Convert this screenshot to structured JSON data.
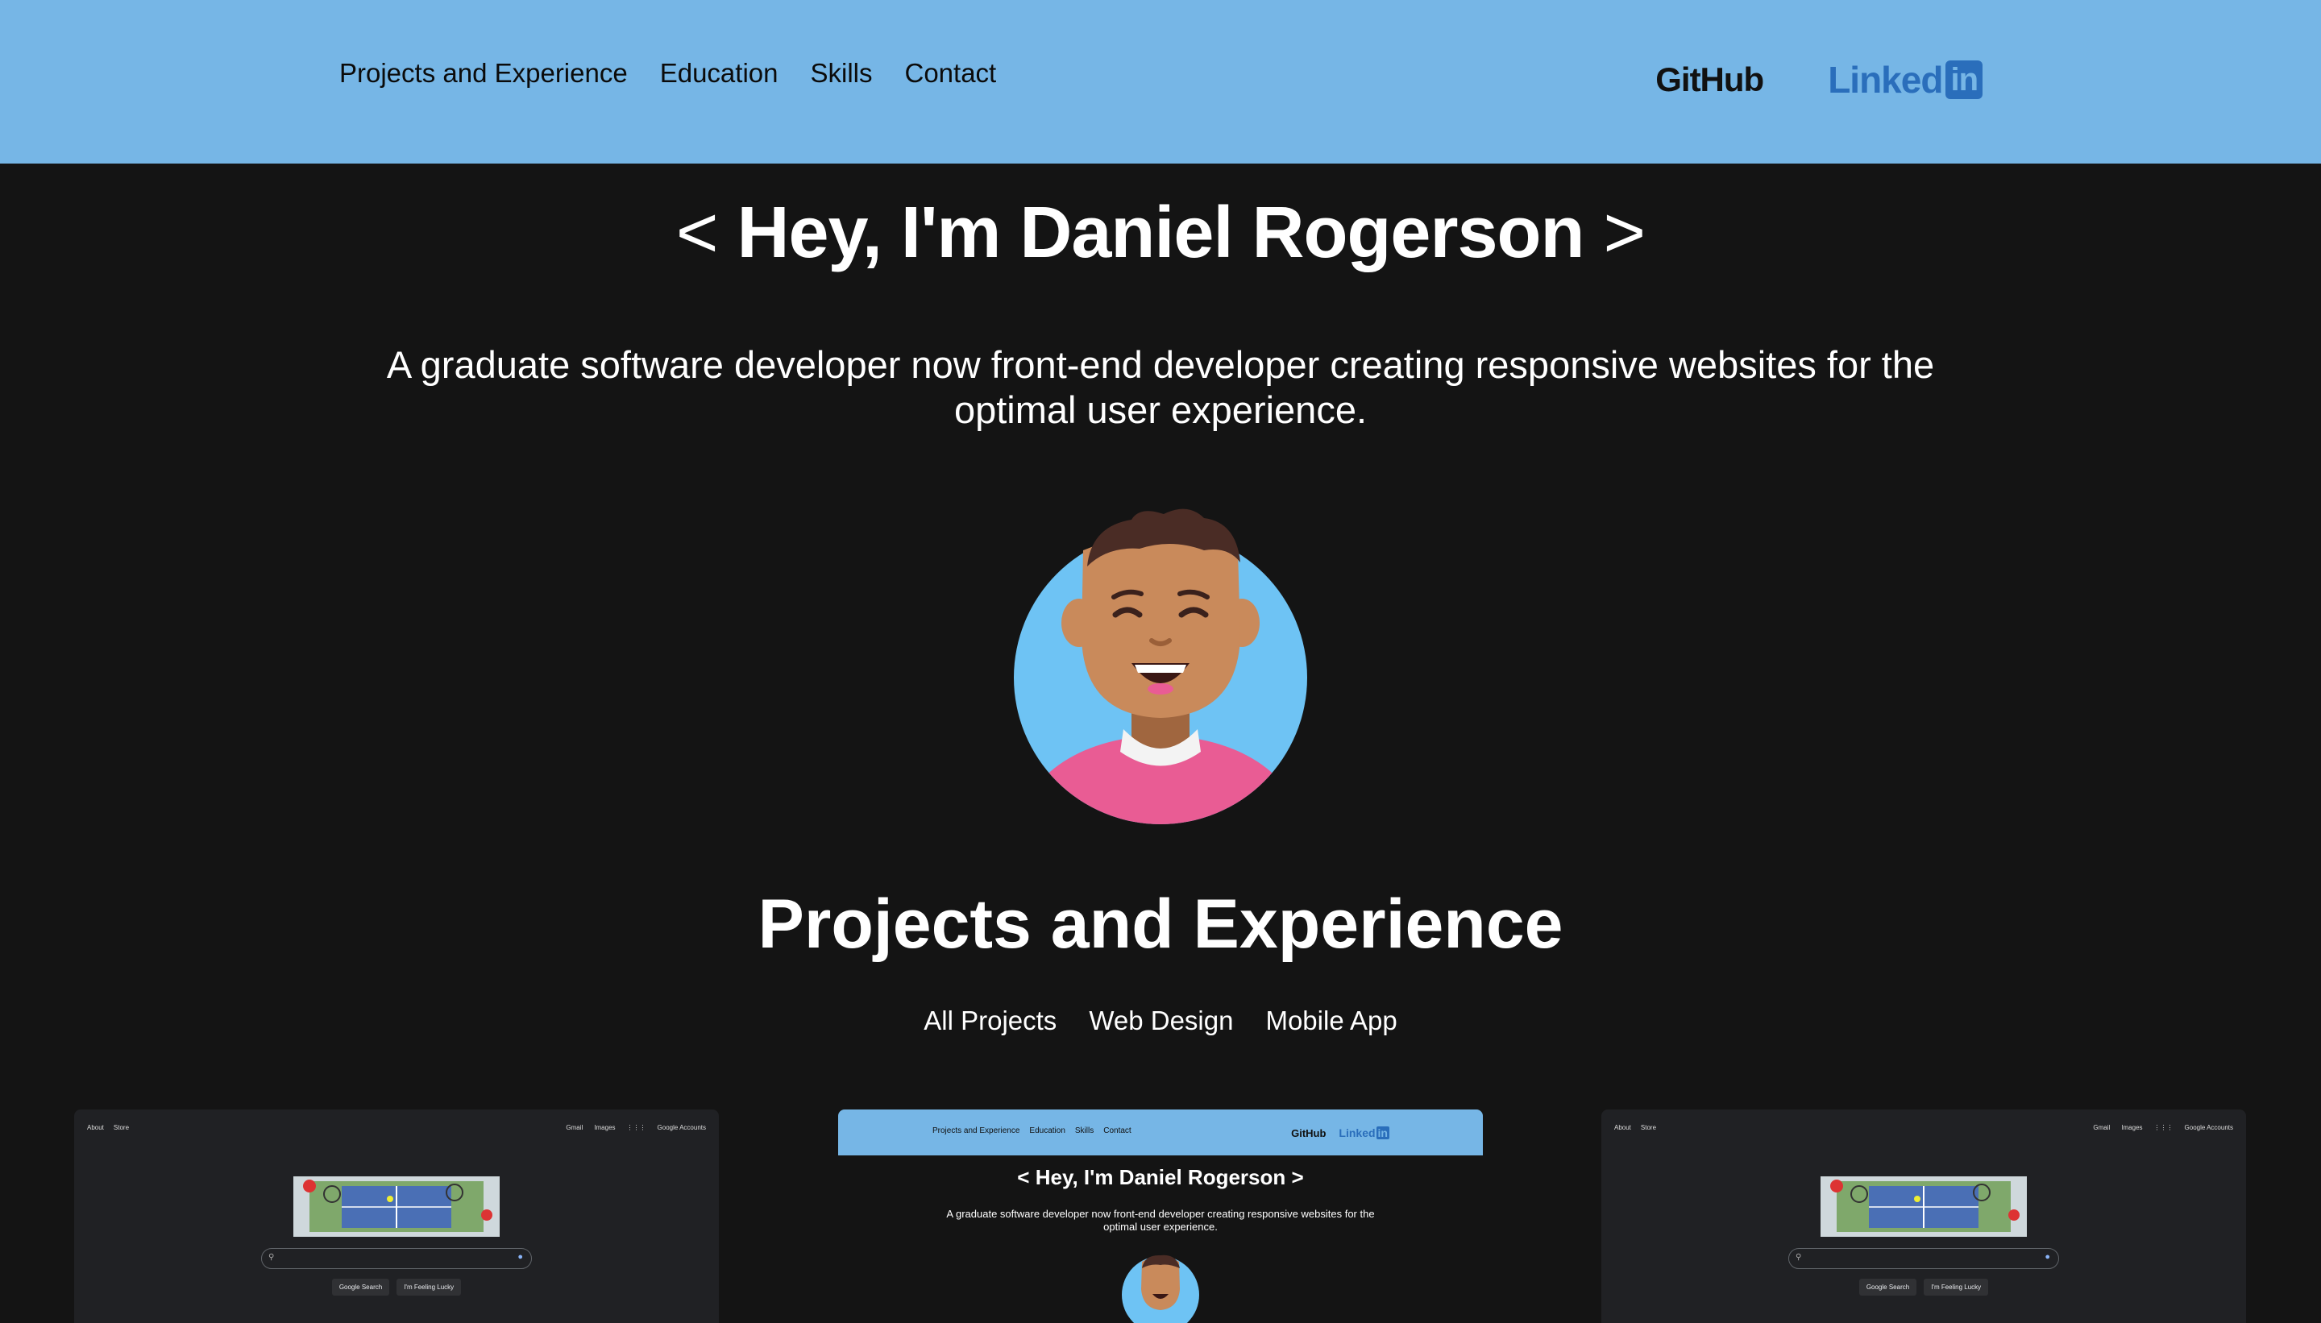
{
  "header": {
    "nav": [
      "Projects and Experience",
      "Education",
      "Skills",
      "Contact"
    ],
    "github": "GitHub",
    "linkedin_text": "Linked",
    "linkedin_box": "in"
  },
  "hero": {
    "title_open": "<",
    "title_name": "Hey, I'm Daniel Rogerson",
    "title_close": ">",
    "subtitle": "A graduate software developer now front-end developer creating responsive websites for the optimal user experience."
  },
  "projects": {
    "title": "Projects and Experience",
    "filters": [
      "All Projects",
      "Web Design",
      "Mobile App"
    ]
  },
  "google_preview": {
    "top_left": [
      "About",
      "Store"
    ],
    "top_right": [
      "Gmail",
      "Images",
      "Google Accounts"
    ],
    "buttons": [
      "Google Search",
      "I'm Feeling Lucky"
    ]
  },
  "colors": {
    "header_bg": "#76b6e6",
    "page_bg": "#141414",
    "linkedin_blue": "#2a6ebb"
  }
}
